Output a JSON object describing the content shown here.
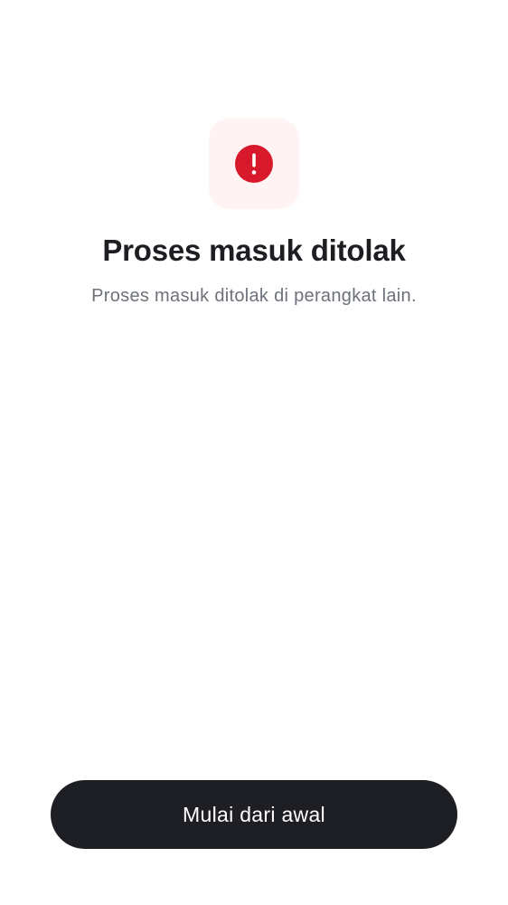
{
  "status": {
    "icon": "alert-icon",
    "title": "Proses masuk ditolak",
    "message": "Proses masuk ditolak di perangkat lain."
  },
  "actions": {
    "restart_label": "Mulai dari awal"
  },
  "colors": {
    "background": "#ffffff",
    "icon_tile_bg": "#fff4f3",
    "alert_red": "#d8192c",
    "title_text": "#1d1e22",
    "subtitle_text": "#6d717a",
    "button_bg": "#1e1f24",
    "button_text": "#ffffff"
  }
}
